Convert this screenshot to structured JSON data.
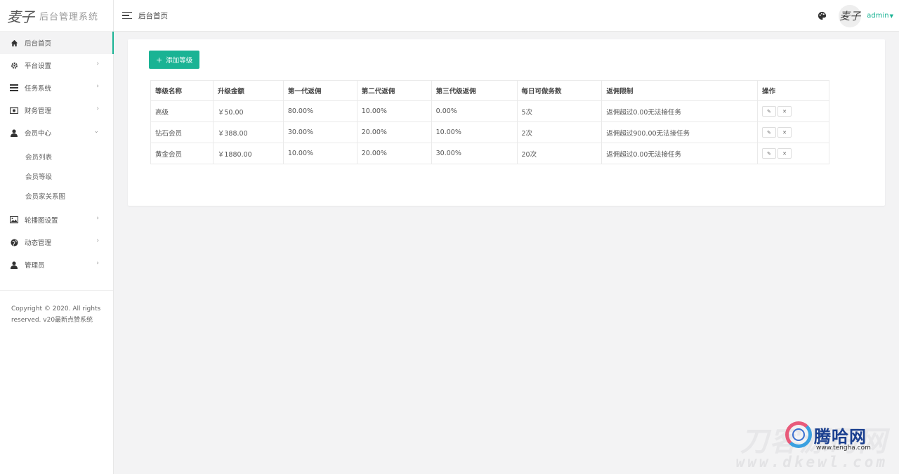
{
  "logo": {
    "mark": "麦子",
    "title": "后台管理系统"
  },
  "header": {
    "breadcrumb": "后台首页",
    "user": "admin"
  },
  "sidebar": {
    "items": [
      {
        "label": "后台首页",
        "icon": "home-icon",
        "arrow": ""
      },
      {
        "label": "平台设置",
        "icon": "gear-icon",
        "arrow": "›"
      },
      {
        "label": "任务系统",
        "icon": "list-icon",
        "arrow": "›"
      },
      {
        "label": "财务管理",
        "icon": "money-icon",
        "arrow": "›"
      },
      {
        "label": "会员中心",
        "icon": "user-icon",
        "arrow": "⌄"
      }
    ],
    "submenu": [
      {
        "label": "会员列表"
      },
      {
        "label": "会员等级"
      },
      {
        "label": "会员家关系图"
      }
    ],
    "items2": [
      {
        "label": "轮播图设置",
        "icon": "image-icon",
        "arrow": "›"
      },
      {
        "label": "动态管理",
        "icon": "globe-icon",
        "arrow": "›"
      },
      {
        "label": "管理员",
        "icon": "user-icon",
        "arrow": "›"
      }
    ],
    "copyright_line1": "Copyright © 2020. All rights",
    "copyright_line2": "reserved. v20最新点赞系统"
  },
  "toolbar": {
    "add_label": "添加等级"
  },
  "table": {
    "headers": [
      "等级名称",
      "升级金额",
      "第一代返佣",
      "第二代返佣",
      "第三代级返佣",
      "每日可做务数",
      "返佣限制",
      "操作"
    ],
    "rows": [
      {
        "name": "高级",
        "amount": "￥50.00",
        "c1": "80.00%",
        "c2": "10.00%",
        "c3": "0.00%",
        "daily": "5次",
        "limit": "返佣超过0.00无法接任务"
      },
      {
        "name": "钻石会员",
        "amount": "￥388.00",
        "c1": "30.00%",
        "c2": "20.00%",
        "c3": "10.00%",
        "daily": "2次",
        "limit": "返佣超过900.00无法接任务"
      },
      {
        "name": "黄金会员",
        "amount": "￥1880.00",
        "c1": "10.00%",
        "c2": "20.00%",
        "c3": "30.00%",
        "daily": "20次",
        "limit": "返佣超过0.00无法接任务"
      }
    ]
  },
  "watermark": {
    "text1": "刀客源码网",
    "brand": "腾哈网",
    "url": "www.tengha.com",
    "text2": "www.dkewl.com"
  },
  "colors": {
    "accent": "#1ab394",
    "background": "#f3f3f4"
  }
}
